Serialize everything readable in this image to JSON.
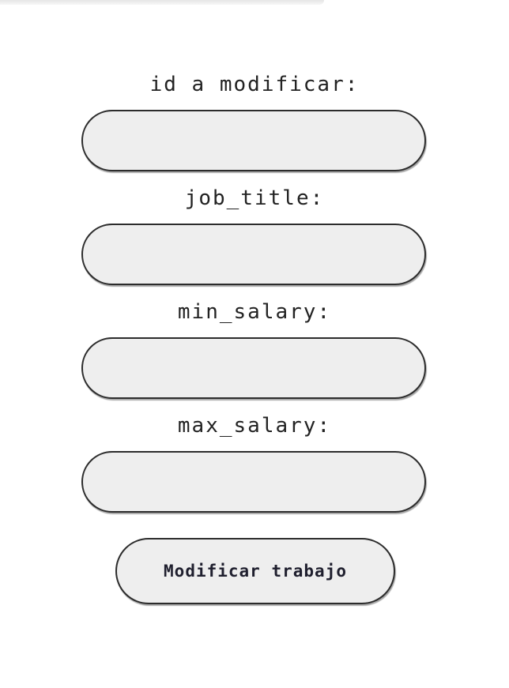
{
  "form": {
    "fields": [
      {
        "label": "id a modificar:",
        "value": ""
      },
      {
        "label": "job_title:",
        "value": ""
      },
      {
        "label": "min_salary:",
        "value": ""
      },
      {
        "label": "max_salary:",
        "value": ""
      }
    ],
    "submit_label": "Modificar trabajo"
  }
}
